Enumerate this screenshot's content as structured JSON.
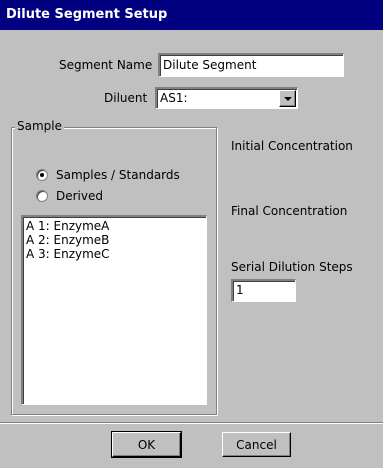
{
  "window": {
    "title": "Dilute Segment Setup"
  },
  "segment_name": {
    "label": "Segment Name",
    "value": "Dilute Segment"
  },
  "diluent": {
    "label": "Diluent",
    "value": "AS1:"
  },
  "sample_group": {
    "title": "Sample",
    "radios": [
      {
        "label": "Samples / Standards",
        "selected": true
      },
      {
        "label": "Derived",
        "selected": false
      }
    ],
    "items": [
      "A 1: EnzymeA",
      "A 2: EnzymeB",
      "A 3: EnzymeC"
    ]
  },
  "initial_concentration": {
    "label": "Initial Concentration"
  },
  "final_concentration": {
    "label": "Final Concentration"
  },
  "serial_dilution": {
    "label": "Serial Dilution Steps",
    "value": "1"
  },
  "buttons": {
    "ok": "OK",
    "cancel": "Cancel"
  }
}
